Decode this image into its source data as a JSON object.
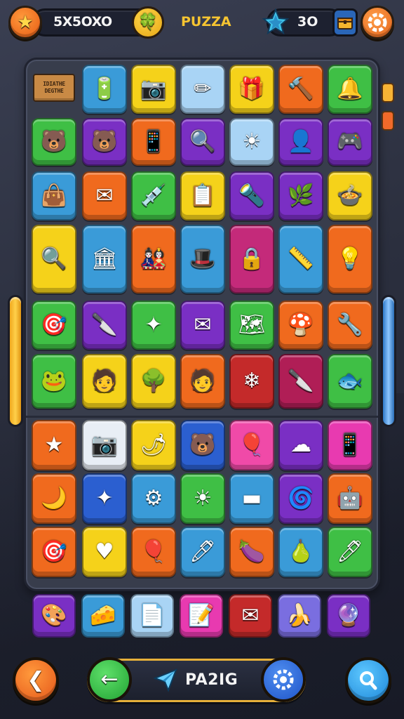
{
  "header": {
    "score": "5X5OXO",
    "title": "PUZZA",
    "gems": "3O"
  },
  "board": {
    "sign_lines": [
      "IDIATHE",
      "DEGTHE"
    ],
    "grid": [
      [
        "",
        "🔋",
        "📷",
        "✏",
        "🎁",
        "🔨",
        "🔔"
      ],
      [
        "🐻",
        "🐻",
        "📱",
        "🔍",
        "☀",
        "👤",
        "🎮"
      ],
      [
        "👜",
        "✉",
        "💉",
        "📋",
        "🔦",
        "🌿",
        "🍲"
      ],
      [
        "🔍",
        "🏛",
        "🎎",
        "🎩",
        "🔒",
        "📏",
        "💡"
      ],
      [
        "🎯",
        "🔪",
        "✦",
        "✉",
        "🗺",
        "🍄",
        "🔧"
      ],
      [
        "🐸",
        "🧑",
        "🌳",
        "🧑",
        "❄",
        "🔪",
        "🐟"
      ],
      [
        "★",
        "📷",
        "🌶",
        "🐻",
        "🎈",
        "☁",
        "📱"
      ],
      [
        "🌙",
        "✦",
        "⚙",
        "☀",
        "▬",
        "🌀",
        "🤖"
      ],
      [
        "🎯",
        "♥",
        "🎈",
        "🖊",
        "🍆",
        "🍐",
        "🖊"
      ]
    ],
    "colors": [
      [
        "sign",
        "#3a9bd8",
        "#f5d21a",
        "#a9d4f5",
        "#f5d21a",
        "#f06a1e",
        "#3fbf45"
      ],
      [
        "#3fbf45",
        "#7a2fc4",
        "#f06a1e",
        "#7a2fc4",
        "#a9d4f5",
        "#7a2fc4",
        "#7a2fc4"
      ],
      [
        "#3a9bd8",
        "#f06a1e",
        "#3fbf45",
        "#f5d21a",
        "#7a2fc4",
        "#7a2fc4",
        "#f5d21a"
      ],
      [
        "#f5d21a",
        "#3a9bd8",
        "#f06a1e",
        "#3a9bd8",
        "#c42a7a",
        "#3a9bd8",
        "#f06a1e"
      ],
      [
        "#3fbf45",
        "#7a2fc4",
        "#3fbf45",
        "#7a2fc4",
        "#3fbf45",
        "#f06a1e",
        "#f06a1e"
      ],
      [
        "#3fbf45",
        "#f5d21a",
        "#f5d21a",
        "#f06a1e",
        "#c42a2a",
        "#b01e56",
        "#3fbf45"
      ],
      [
        "#f06a1e",
        "#e8eef5",
        "#f5d21a",
        "#2b5fd0",
        "#f04aa8",
        "#7a2fc4",
        "#e83ab0"
      ],
      [
        "#f06a1e",
        "#2b5fd0",
        "#3a9bd8",
        "#3fbf45",
        "#3a9bd8",
        "#7a2fc4",
        "#f06a1e"
      ],
      [
        "#f06a1e",
        "#f5d21a",
        "#f06a1e",
        "#3a9bd8",
        "#f06a1e",
        "#3a9bd8",
        "#3fbf45"
      ]
    ]
  },
  "tray": {
    "items": [
      "🎨",
      "🧀",
      "📄",
      "📝",
      "✉",
      "🍌",
      "🔮"
    ],
    "colors": [
      "#7a2fc4",
      "#3a9bd8",
      "#a9d4f5",
      "#e83ab0",
      "#c42a2a",
      "#7a6ee0",
      "#7a2fc4"
    ]
  },
  "footer": {
    "action_label": "PA2IG"
  },
  "icons": {
    "star": "★",
    "gold": "🍀",
    "gem": "✦",
    "chest": "▣",
    "settings": "⚙",
    "back": "❮",
    "confirm": "←",
    "plane": "✈",
    "gear": "⚙",
    "search": "⌕"
  }
}
